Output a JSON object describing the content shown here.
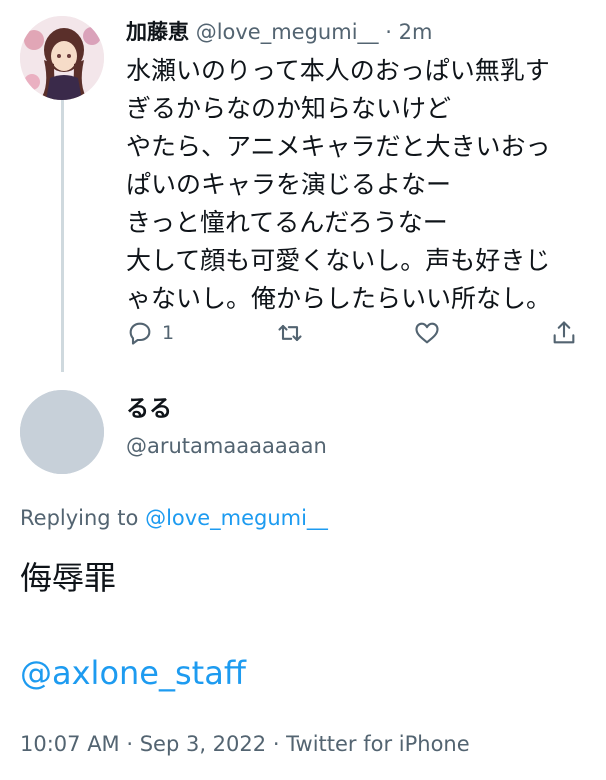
{
  "original_tweet": {
    "display_name": "加藤恵",
    "handle": "@love_megumi__",
    "separator": "·",
    "time": "2m",
    "avatar_icon": "anime-girl-avatar",
    "body_lines": [
      "水瀬いのりって本人のおっぱい無乳す",
      "ぎるからなのか知らないけど",
      "やたら、アニメキャラだと大きいおっ",
      "ぱいのキャラを演じるよなー",
      "きっと憧れてるんだろうなー",
      "大して顔も可愛くないし。声も好きじ",
      "ゃないし。俺からしたらいい所なし。"
    ],
    "actions": {
      "reply_icon": "reply-icon",
      "reply_count": "1",
      "retweet_icon": "retweet-icon",
      "like_icon": "heart-icon",
      "share_icon": "share-icon"
    }
  },
  "reply_tweet": {
    "display_name": "るる",
    "handle": "@arutamaaaaaaan",
    "avatar_icon": "default-avatar",
    "replying_to_prefix": "Replying to ",
    "replying_to_handle": "@love_megumi__",
    "text": "侮辱罪",
    "mention": "@axlone_staff",
    "timestamp": "10:07 AM",
    "date": "Sep 3, 2022",
    "source": "Twitter for iPhone",
    "meta_separator": " · "
  },
  "colors": {
    "text_primary": "#0f1419",
    "text_secondary": "#536471",
    "link": "#1d9bf0",
    "thread_line": "#cfd9de",
    "default_avatar": "#c7d0d9"
  }
}
